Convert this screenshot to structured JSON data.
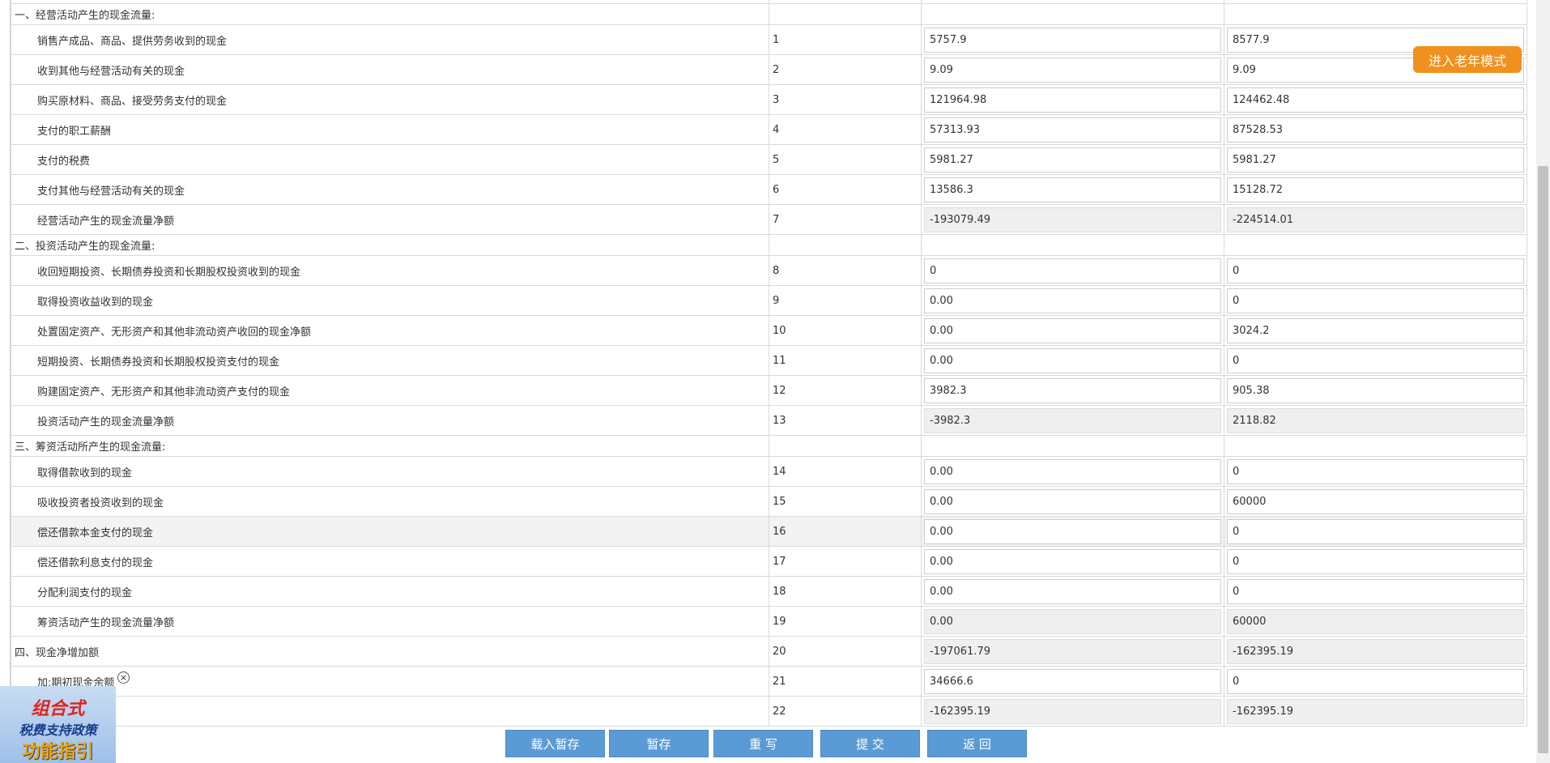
{
  "colors": {
    "button_bg": "#5b9bd5",
    "elder_button_bg": "#f0901e",
    "readonly_bg": "#efefef"
  },
  "elder_mode_label": "进入老年模式",
  "rows": [
    {
      "type": "section",
      "name": "一、经营活动产生的现金流量:"
    },
    {
      "type": "item",
      "name": "销售产成品、商品、提供劳务收到的现金",
      "no": "1",
      "current": "5757.9",
      "previous": "8577.9",
      "readonly": false
    },
    {
      "type": "item",
      "name": "收到其他与经营活动有关的现金",
      "no": "2",
      "current": "9.09",
      "previous": "9.09",
      "readonly": false
    },
    {
      "type": "item",
      "name": "购买原材料、商品、接受劳务支付的现金",
      "no": "3",
      "current": "121964.98",
      "previous": "124462.48",
      "readonly": false
    },
    {
      "type": "item",
      "name": "支付的职工薪酬",
      "no": "4",
      "current": "57313.93",
      "previous": "87528.53",
      "readonly": false
    },
    {
      "type": "item",
      "name": "支付的税费",
      "no": "5",
      "current": "5981.27",
      "previous": "5981.27",
      "readonly": false
    },
    {
      "type": "item",
      "name": "支付其他与经营活动有关的现金",
      "no": "6",
      "current": "13586.3",
      "previous": "15128.72",
      "readonly": false
    },
    {
      "type": "item",
      "name": "经营活动产生的现金流量净额",
      "no": "7",
      "current": "-193079.49",
      "previous": "-224514.01",
      "readonly": true
    },
    {
      "type": "section",
      "name": "二、投资活动产生的现金流量:"
    },
    {
      "type": "item",
      "name": "收回短期投资、长期债券投资和长期股权投资收到的现金",
      "no": "8",
      "current": "0",
      "previous": "0",
      "readonly": false
    },
    {
      "type": "item",
      "name": "取得投资收益收到的现金",
      "no": "9",
      "current": "0.00",
      "previous": "0",
      "readonly": false
    },
    {
      "type": "item",
      "name": "处置固定资产、无形资产和其他非流动资产收回的现金净额",
      "no": "10",
      "current": "0.00",
      "previous": "3024.2",
      "readonly": false
    },
    {
      "type": "item",
      "name": "短期投资、长期债券投资和长期股权投资支付的现金",
      "no": "11",
      "current": "0.00",
      "previous": "0",
      "readonly": false
    },
    {
      "type": "item",
      "name": "购建固定资产、无形资产和其他非流动资产支付的现金",
      "no": "12",
      "current": "3982.3",
      "previous": "905.38",
      "readonly": false
    },
    {
      "type": "item",
      "name": "投资活动产生的现金流量净额",
      "no": "13",
      "current": "-3982.3",
      "previous": "2118.82",
      "readonly": true
    },
    {
      "type": "section",
      "name": "三、筹资活动所产生的现金流量:"
    },
    {
      "type": "item",
      "name": "取得借款收到的现金",
      "no": "14",
      "current": "0.00",
      "previous": "0",
      "readonly": false
    },
    {
      "type": "item",
      "name": "吸收投资者投资收到的现金",
      "no": "15",
      "current": "0.00",
      "previous": "60000",
      "readonly": false
    },
    {
      "type": "item",
      "name": "偿还借款本金支付的现金",
      "no": "16",
      "current": "0.00",
      "previous": "0",
      "readonly": false,
      "highlight": true
    },
    {
      "type": "item",
      "name": "偿还借款利息支付的现金",
      "no": "17",
      "current": "0.00",
      "previous": "0",
      "readonly": false
    },
    {
      "type": "item",
      "name": "分配利润支付的现金",
      "no": "18",
      "current": "0.00",
      "previous": "0",
      "readonly": false
    },
    {
      "type": "item",
      "name": "筹资活动产生的现金流量净额",
      "no": "19",
      "current": "0.00",
      "previous": "60000",
      "readonly": true
    },
    {
      "type": "item",
      "name": "四、现金净增加额",
      "no": "20",
      "current": "-197061.79",
      "previous": "-162395.19",
      "readonly": true,
      "top": true
    },
    {
      "type": "item",
      "name": "加:期初现金余额",
      "no": "21",
      "current": "34666.6",
      "previous": "0",
      "readonly": false
    },
    {
      "type": "item",
      "name": "",
      "no": "22",
      "current": "-162395.19",
      "previous": "-162395.19",
      "readonly": true
    }
  ],
  "toolbar": {
    "load_draft": "载入暂存",
    "save_draft": "暂存",
    "rewrite": "重 写",
    "submit": "提 交",
    "back": "返 回"
  },
  "promo": {
    "line1": "组合式",
    "line2": "税费支持政策",
    "line3": "功能指引",
    "close_glyph": "×"
  }
}
